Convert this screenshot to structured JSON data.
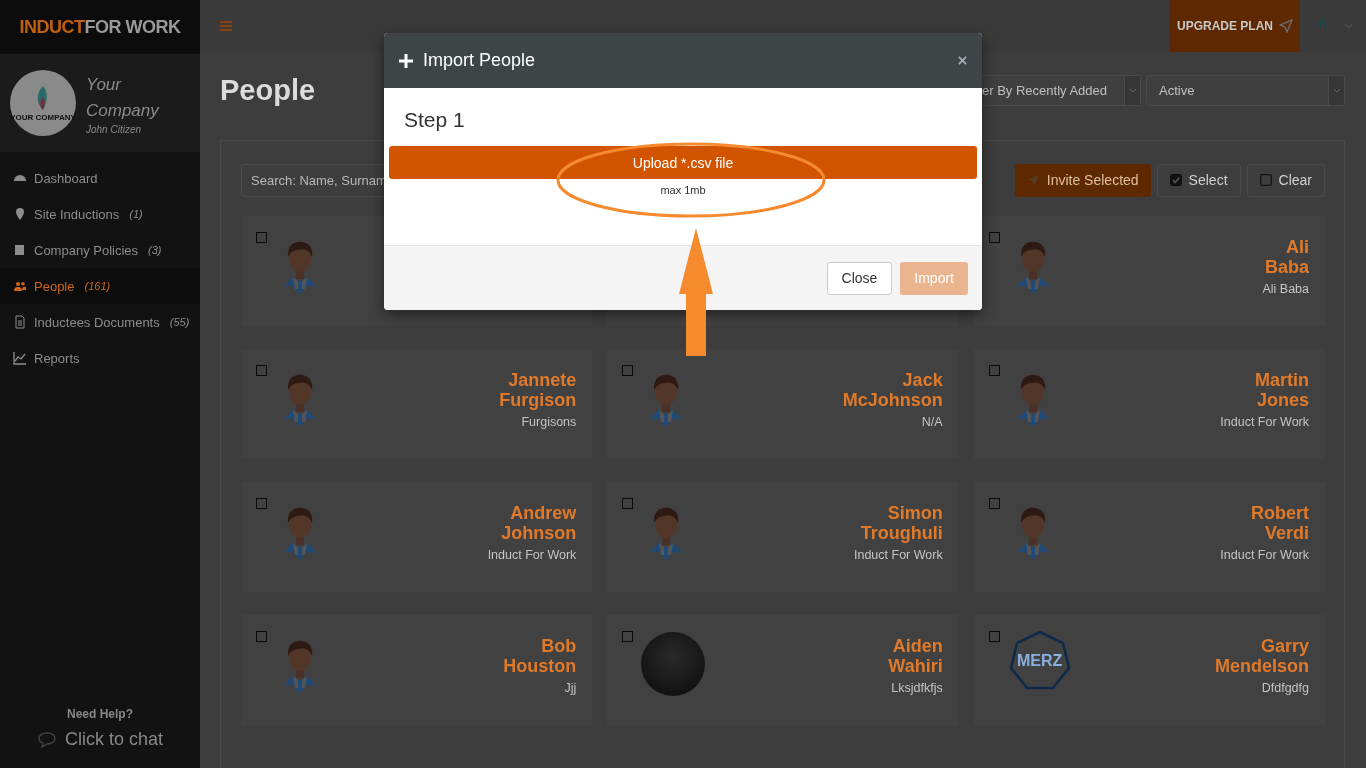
{
  "sidebar": {
    "logo": {
      "part_1": "INDUCT",
      "part_2": "FOR WORK"
    },
    "company_logo_text": "YOUR COMPANY",
    "company": "Your Company",
    "user": "John Citizen",
    "items": [
      {
        "label": "Dashboard",
        "selected": false
      },
      {
        "label": "Site Inductions",
        "count": "(1)",
        "selected": false
      },
      {
        "label": "Company Policies",
        "count": "(3)",
        "selected": false
      },
      {
        "label": "People",
        "count": "(161)",
        "selected": true
      },
      {
        "label": "Inductees Documents",
        "count": "(55)",
        "selected": false
      },
      {
        "label": "Reports",
        "selected": false
      }
    ],
    "help": {
      "title": "Need Help?",
      "link": "Click to chat"
    }
  },
  "topbar": {
    "upgrade": "UPGRADE PLAN"
  },
  "page": {
    "title": "People",
    "sort_select": "er By Recently Added",
    "status_select": "Active",
    "search_placeholder": "Search: Name, Surnam",
    "actions": {
      "invite": "Invite Selected",
      "select": "Select",
      "clear": "Clear"
    },
    "cards": [
      {
        "checked": false,
        "kind": "silhouette"
      },
      {
        "kind": "covered"
      },
      {
        "checked": false,
        "kind": "silhouette",
        "first": "Ali",
        "last": "Baba",
        "company": "Ali Baba"
      },
      {
        "checked": false,
        "kind": "silhouette",
        "first": "Jannete",
        "last": "Furgison",
        "company": "Furgisons"
      },
      {
        "checked": false,
        "kind": "silhouette",
        "first": "Jack",
        "last": "McJohnson",
        "company": "N/A"
      },
      {
        "checked": false,
        "kind": "silhouette",
        "first": "Martin",
        "last": "Jones",
        "company": "Induct For Work"
      },
      {
        "checked": false,
        "kind": "silhouette",
        "first": "Andrew",
        "last": "Johnson",
        "company": "Induct For Work"
      },
      {
        "checked": false,
        "kind": "silhouette",
        "first": "Simon",
        "last": "Troughuli",
        "company": "Induct For Work"
      },
      {
        "checked": false,
        "kind": "silhouette",
        "first": "Robert",
        "last": "Verdi",
        "company": "Induct For Work"
      },
      {
        "checked": false,
        "kind": "silhouette",
        "first": "Bob",
        "last": "Houston",
        "company": "Jjj"
      },
      {
        "checked": false,
        "kind": "photo",
        "first": "Aiden",
        "last": "Wahiri",
        "company": "Lksjdfkfjs"
      },
      {
        "checked": false,
        "kind": "logo",
        "logo_text": "MERZ",
        "first": "Garry",
        "last": "Mendelson",
        "company": "Dfdfgdfg"
      }
    ]
  },
  "modal": {
    "title": "Import People",
    "step": "Step 1",
    "upload": "Upload *.csv file",
    "hint": "max 1mb",
    "buttons": [
      {
        "label": "Close",
        "kind": "default",
        "disabled": false
      },
      {
        "label": "Import",
        "kind": "primary",
        "disabled": true
      }
    ]
  }
}
